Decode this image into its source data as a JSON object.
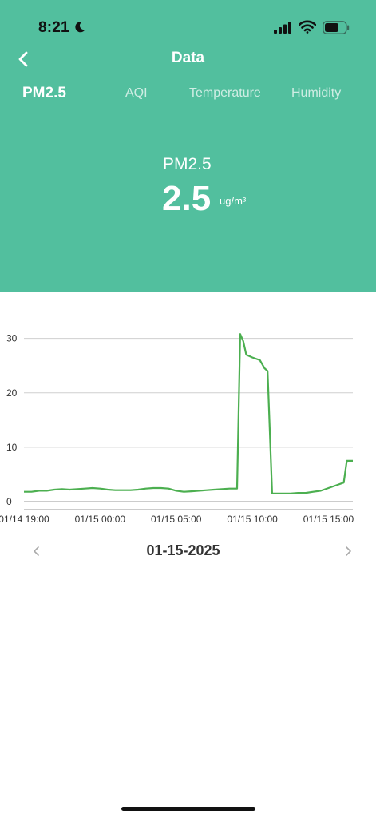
{
  "status_bar": {
    "time": "8:21"
  },
  "header": {
    "title": "Data",
    "tabs": [
      {
        "label": "PM2.5",
        "active": true
      },
      {
        "label": "AQI",
        "active": false
      },
      {
        "label": "Temperature",
        "active": false
      },
      {
        "label": "Humidity",
        "active": false
      }
    ],
    "background_color": "#52bf9e"
  },
  "metric": {
    "label": "PM2.5",
    "value": "2.5",
    "unit": "ug/m³"
  },
  "chart_data": {
    "type": "line",
    "series": [
      {
        "color": "#4caf50",
        "points": [
          [
            0,
            1.8
          ],
          [
            0.5,
            1.8
          ],
          [
            1,
            2.0
          ],
          [
            1.5,
            2.0
          ],
          [
            2,
            2.2
          ],
          [
            2.5,
            2.3
          ],
          [
            3,
            2.2
          ],
          [
            3.5,
            2.3
          ],
          [
            4,
            2.4
          ],
          [
            4.5,
            2.5
          ],
          [
            5,
            2.4
          ],
          [
            5.5,
            2.2
          ],
          [
            6,
            2.1
          ],
          [
            6.5,
            2.1
          ],
          [
            7,
            2.1
          ],
          [
            7.5,
            2.2
          ],
          [
            8,
            2.4
          ],
          [
            8.5,
            2.5
          ],
          [
            9,
            2.5
          ],
          [
            9.5,
            2.4
          ],
          [
            10,
            2.0
          ],
          [
            10.5,
            1.8
          ],
          [
            11,
            1.9
          ],
          [
            11.5,
            2.0
          ],
          [
            12,
            2.1
          ],
          [
            12.5,
            2.2
          ],
          [
            13,
            2.3
          ],
          [
            13.5,
            2.4
          ],
          [
            14,
            2.4
          ],
          [
            14.2,
            30.8
          ],
          [
            14.4,
            29.5
          ],
          [
            14.6,
            27.0
          ],
          [
            15,
            26.5
          ],
          [
            15.5,
            26.0
          ],
          [
            15.8,
            24.5
          ],
          [
            16,
            24.0
          ],
          [
            16.3,
            1.5
          ],
          [
            17,
            1.5
          ],
          [
            17.5,
            1.5
          ],
          [
            18,
            1.6
          ],
          [
            18.5,
            1.6
          ],
          [
            19,
            1.8
          ],
          [
            19.5,
            2.0
          ],
          [
            20,
            2.5
          ],
          [
            20.5,
            3.0
          ],
          [
            21,
            3.5
          ],
          [
            21.2,
            7.5
          ],
          [
            21.6,
            7.5
          ]
        ]
      }
    ],
    "y_ticks": [
      0,
      10,
      20,
      30
    ],
    "ylim": [
      0,
      32
    ],
    "x_ticks": [
      {
        "x": 0,
        "label": "01/14 19:00"
      },
      {
        "x": 5,
        "label": "01/15 00:00"
      },
      {
        "x": 10,
        "label": "01/15 05:00"
      },
      {
        "x": 15,
        "label": "01/15 10:00"
      },
      {
        "x": 20,
        "label": "01/15 15:00"
      }
    ],
    "xlim": [
      0,
      21.6
    ],
    "grid": true
  },
  "date_nav": {
    "date": "01-15-2025"
  },
  "icons": {
    "back": "chevron-left-icon",
    "prev": "chevron-left-icon",
    "next": "chevron-right-icon",
    "moon": "moon-icon",
    "signal": "cellular-signal-icon",
    "wifi": "wifi-icon",
    "battery": "battery-icon"
  }
}
